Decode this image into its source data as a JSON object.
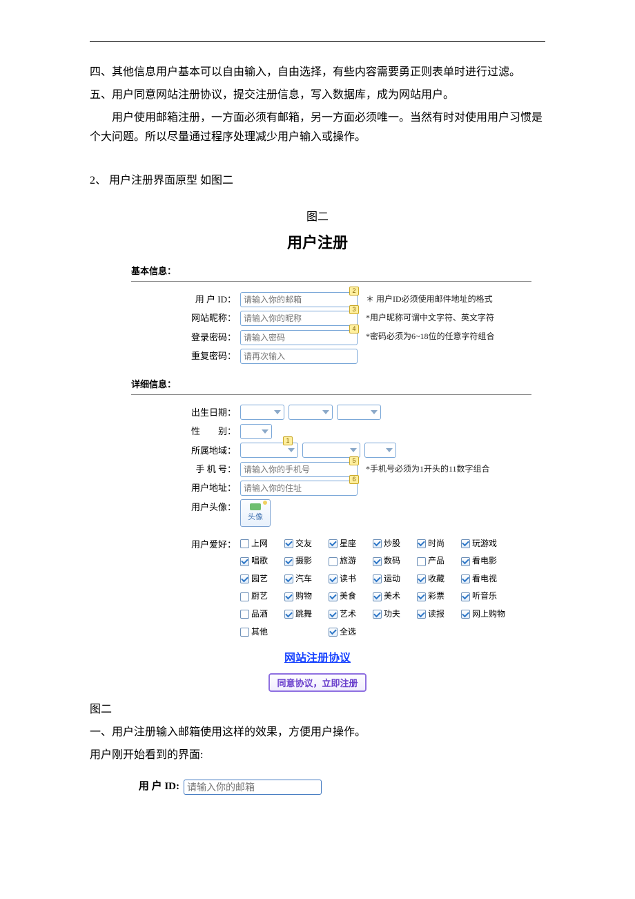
{
  "doc": {
    "p1": "四、其他信息用户基本可以自由输入，自由选择，有些内容需要勇正则表单时进行过滤。",
    "p2": "五、用户同意网站注册协议，提交注册信息，写入数据库，成为网站用户。",
    "p3": "用户使用邮箱注册，一方面必须有邮箱，另一方面必须唯一。当然有时对使用用户习惯是个大问题。所以尽量通过程序处理减少用户输入或操作。",
    "p4": "2、 用户注册界面原型  如图二",
    "fig_caption_top": "图二",
    "reg_title": "用户注册",
    "fig_caption_below": "图二",
    "p5": "一、用户注册输入邮箱使用这样的效果，方便用户操作。",
    "p6": "用户刚开始看到的界面:"
  },
  "sections": {
    "basic": "基本信息：",
    "detail": "详细信息："
  },
  "fields": {
    "user_id": {
      "label": "用 户 ID：",
      "placeholder": "请输入你的邮箱",
      "hint": "＊ 用户ID必须使用邮件地址的格式",
      "badge": "2"
    },
    "nickname": {
      "label": "网站昵称：",
      "placeholder": "请输入你的昵称",
      "hint": "*用户昵称可谓中文字符、英文字符",
      "badge": "3"
    },
    "password": {
      "label": "登录密码：",
      "placeholder": "请输入密码",
      "hint": "*密码必须为6~18位的任意字符组合",
      "badge": "4"
    },
    "password2": {
      "label": "重复密码：",
      "placeholder": "请再次输入"
    },
    "birth": {
      "label": "出生日期："
    },
    "gender": {
      "label": "性　　别："
    },
    "region": {
      "label": "所属地域：",
      "badge": "1"
    },
    "phone": {
      "label": "手 机 号：",
      "placeholder": "请输入你的手机号",
      "hint": "*手机号必须为1开头的11数字组合",
      "badge": "5"
    },
    "address": {
      "label": "用户地址：",
      "placeholder": "请输入你的住址",
      "badge": "6"
    },
    "avatar": {
      "label": "用户头像：",
      "thumb_label": "头像"
    },
    "hobby": {
      "label": "用户爱好："
    }
  },
  "hobbies": [
    [
      {
        "t": "上网",
        "c": false
      },
      {
        "t": "交友",
        "c": true
      },
      {
        "t": "星座",
        "c": true
      },
      {
        "t": "炒股",
        "c": true
      },
      {
        "t": "时尚",
        "c": true
      },
      {
        "t": "玩游戏",
        "c": true
      }
    ],
    [
      {
        "t": "唱歌",
        "c": true
      },
      {
        "t": "摄影",
        "c": true
      },
      {
        "t": "旅游",
        "c": false
      },
      {
        "t": "数码",
        "c": true
      },
      {
        "t": "产品",
        "c": false
      },
      {
        "t": "看电影",
        "c": true
      }
    ],
    [
      {
        "t": "园艺",
        "c": true
      },
      {
        "t": "汽车",
        "c": true
      },
      {
        "t": "读书",
        "c": true
      },
      {
        "t": "运动",
        "c": true
      },
      {
        "t": "收藏",
        "c": true
      },
      {
        "t": "看电视",
        "c": true
      }
    ],
    [
      {
        "t": "厨艺",
        "c": false
      },
      {
        "t": "购物",
        "c": true
      },
      {
        "t": "美食",
        "c": true
      },
      {
        "t": "美术",
        "c": true
      },
      {
        "t": "彩票",
        "c": true
      },
      {
        "t": "听音乐",
        "c": true
      }
    ],
    [
      {
        "t": "品酒",
        "c": false
      },
      {
        "t": "跳舞",
        "c": true
      },
      {
        "t": "艺术",
        "c": true
      },
      {
        "t": "功夫",
        "c": true
      },
      {
        "t": "读报",
        "c": true
      },
      {
        "t": "网上购物",
        "c": true
      }
    ],
    [
      {
        "t": "其他",
        "c": false
      },
      null,
      {
        "t": "全选",
        "c": true
      },
      null,
      null,
      null
    ]
  ],
  "agreement": {
    "link": "网站注册协议",
    "button": "同意协议，立即注册"
  },
  "snippet": {
    "label": "用 户 ID:",
    "placeholder": "请输入你的邮箱"
  }
}
